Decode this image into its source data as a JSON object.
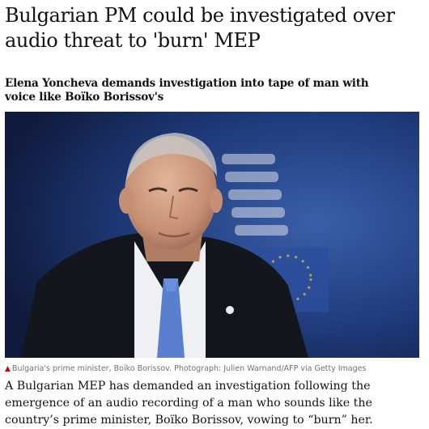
{
  "article": {
    "headline": "Bulgarian PM could be investigated over audio threat to 'burn' MEP",
    "standfirst": "Elena Yoncheva demands investigation into tape of man with voice like Boïko Borissov's",
    "image": {
      "caption_icon": "red-triangle-icon",
      "caption": "Bulgaria's prime minister, Boïko Borissov. Photograph: Julien Warnand/AFP via Getty Images"
    },
    "body": "A Bulgarian MEP has demanded an investigation following the emergence of an audio recording of a man who sounds like the country’s prime minister, Boïko Borissov, vowing to “burn” her."
  },
  "colors": {
    "accent": "#c70000",
    "text": "#121212",
    "caption": "#707070"
  }
}
